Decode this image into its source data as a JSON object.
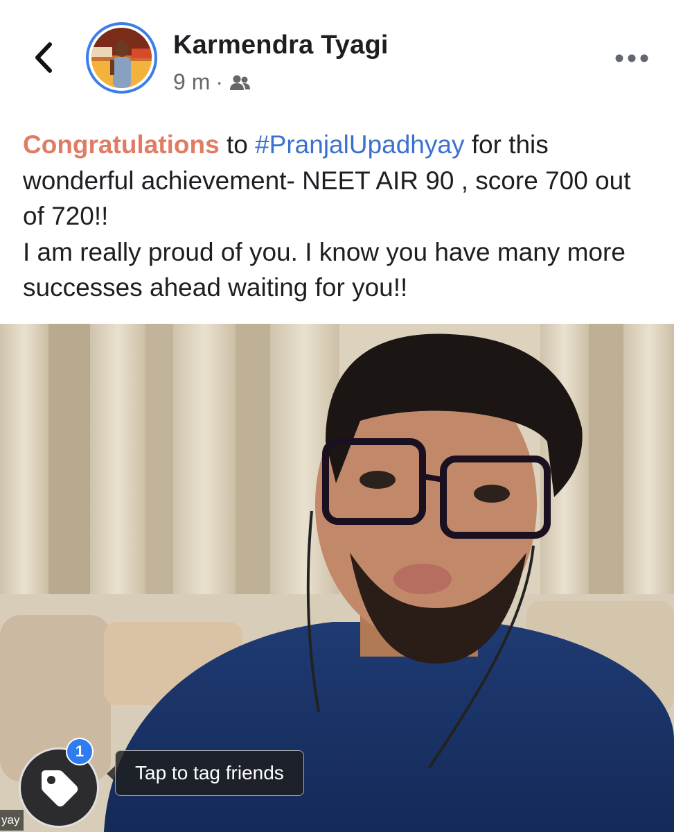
{
  "header": {
    "back_icon": "chevron-left-icon",
    "author_name": "Karmendra Tyagi",
    "timestamp": "9 m",
    "separator": "·",
    "audience_icon": "friends-icon",
    "more_icon": "more-horizontal-icon",
    "avatar_ring_color": "#3b7de9"
  },
  "post": {
    "line1_highlight": "Congratulations",
    "line1_to": " to ",
    "hashtag": "#PranjalUpadhyay",
    "line1_rest": " for this wonderful achievement- NEET AIR 90 , score 700 out of 720!!",
    "line2": "I am really proud of you. I know you have many more successes ahead waiting for you!!",
    "highlight_color": "#e17c64",
    "hashtag_color": "#3b6fd0"
  },
  "photo": {
    "tag_icon": "tag-icon",
    "tag_badge_count": "1",
    "tooltip_text": "Tap to tag friends",
    "name_label": "yay",
    "badge_color": "#2f7cf0"
  }
}
